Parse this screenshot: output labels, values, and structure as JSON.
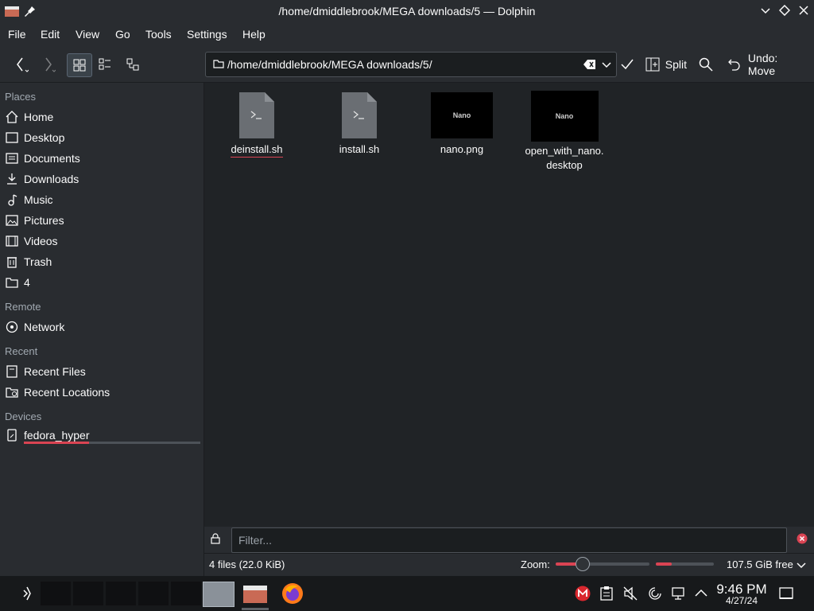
{
  "window": {
    "title": "/home/dmiddlebrook/MEGA downloads/5 — Dolphin",
    "controls": [
      "minimize-icon",
      "maximize-icon",
      "close-icon"
    ]
  },
  "menubar": [
    "File",
    "Edit",
    "View",
    "Go",
    "Tools",
    "Settings",
    "Help"
  ],
  "toolbar": {
    "path": "/home/dmiddlebrook/MEGA downloads/5/",
    "split_label": "Split",
    "undo_label": "Undo: Move"
  },
  "sidebar": {
    "places_header": "Places",
    "places": [
      {
        "label": "Home",
        "icon": "home-icon"
      },
      {
        "label": "Desktop",
        "icon": "desktop-icon"
      },
      {
        "label": "Documents",
        "icon": "documents-icon"
      },
      {
        "label": "Downloads",
        "icon": "downloads-icon"
      },
      {
        "label": "Music",
        "icon": "music-icon"
      },
      {
        "label": "Pictures",
        "icon": "pictures-icon"
      },
      {
        "label": "Videos",
        "icon": "videos-icon"
      },
      {
        "label": "Trash",
        "icon": "trash-icon"
      },
      {
        "label": "4",
        "icon": "folder-icon"
      }
    ],
    "remote_header": "Remote",
    "remote": [
      {
        "label": "Network",
        "icon": "network-icon"
      }
    ],
    "recent_header": "Recent",
    "recent": [
      {
        "label": "Recent Files",
        "icon": "recent-files-icon"
      },
      {
        "label": "Recent Locations",
        "icon": "recent-locations-icon"
      }
    ],
    "devices_header": "Devices",
    "devices": [
      {
        "label": "fedora_hyper",
        "icon": "drive-icon"
      }
    ]
  },
  "files": [
    {
      "name": "deinstall.sh",
      "type": "script"
    },
    {
      "name": "install.sh",
      "type": "script"
    },
    {
      "name": "nano.png",
      "type": "image",
      "thumb_text": "Nano"
    },
    {
      "name_line1": "open_with_nano.",
      "name_line2": "desktop",
      "type": "image",
      "thumb_text": "Nano"
    }
  ],
  "filter": {
    "placeholder": "Filter..."
  },
  "status": {
    "summary": "4 files (22.0 KiB)",
    "zoom_label": "Zoom:",
    "free": "107.5 GiB free"
  },
  "taskbar": {
    "time": "9:46 PM",
    "date": "4/27/24"
  },
  "colors": {
    "accent": "#da4453",
    "background": "#202326",
    "panel": "#292c30"
  }
}
